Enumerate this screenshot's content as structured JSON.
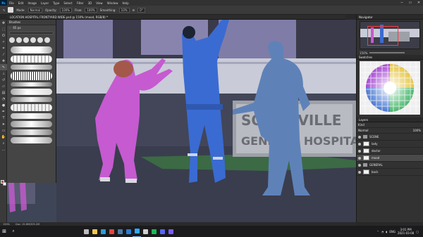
{
  "menubar": {
    "logo": "Ps",
    "items": [
      "File",
      "Edit",
      "Image",
      "Layer",
      "Type",
      "Select",
      "Filter",
      "3D",
      "View",
      "Window",
      "Help"
    ],
    "window_controls": [
      "─",
      "▭",
      "✕"
    ]
  },
  "options_bar": {
    "mode_label": "Mode:",
    "mode_value": "Normal",
    "opacity_label": "Opacity:",
    "opacity_value": "100%",
    "flow_label": "Flow:",
    "flow_value": "100%",
    "smoothing_label": "Smoothing:",
    "smoothing_value": "10%",
    "angle_value": "0°"
  },
  "document_tab": {
    "title": "LOCATION HOSPITAL FRONTYARD WIDE.psd @ 150% (mood, RGB/8) *"
  },
  "brushes_panel": {
    "title": "Brushes",
    "size_value": "65 px"
  },
  "canvas": {
    "sign_line1": "SOMERVILLE",
    "sign_line2": "GENERAL HOSPITAL",
    "colors": {
      "sky": "#2b2b36",
      "building": "#c9cbd8",
      "window": "#8a86b4",
      "ground": "#424658",
      "grass": "#3b6a45",
      "pink": "#c65ad0",
      "blue_suit": "#3a6bd2",
      "silhouette": "#5e82b8"
    }
  },
  "status_bar": {
    "zoom": "150%",
    "doc_info": "Doc: 15.8M/305.2M"
  },
  "navigator_panel": {
    "title": "Navigator",
    "zoom": "150%"
  },
  "swatches_panel": {
    "title": "Swatches"
  },
  "layers_panel": {
    "title": "Layers",
    "kind_filter": "Kind",
    "blend_mode": "Normal",
    "opacity": "100%",
    "rows": [
      {
        "name": "SCENE",
        "type": "folder",
        "selected": false
      },
      {
        "name": "lady",
        "type": "layer",
        "selected": false
      },
      {
        "name": "doctor",
        "type": "layer",
        "selected": false
      },
      {
        "name": "mood",
        "type": "layer",
        "selected": true
      },
      {
        "name": "GENERAL",
        "type": "folder",
        "selected": false
      },
      {
        "name": "back",
        "type": "layer",
        "selected": false
      }
    ]
  },
  "taskbar": {
    "apps": [
      {
        "name": "task-view",
        "color": "#bcbcbc"
      },
      {
        "name": "file-explorer",
        "color": "#f2c84b"
      },
      {
        "name": "edge",
        "color": "#2f9bd9"
      },
      {
        "name": "chrome",
        "color": "#e6453c"
      },
      {
        "name": "steam",
        "color": "#4a7ba8"
      },
      {
        "name": "mail",
        "color": "#2b7cd3"
      },
      {
        "name": "photoshop",
        "color": "#31a8ff"
      },
      {
        "name": "obs",
        "color": "#cfcfcf"
      },
      {
        "name": "spotify",
        "color": "#1db954"
      },
      {
        "name": "discord",
        "color": "#5865f2"
      },
      {
        "name": "media",
        "color": "#7a5cff"
      }
    ],
    "language": "ENG",
    "time": "3:01 PM",
    "date": "2021-03-08"
  }
}
